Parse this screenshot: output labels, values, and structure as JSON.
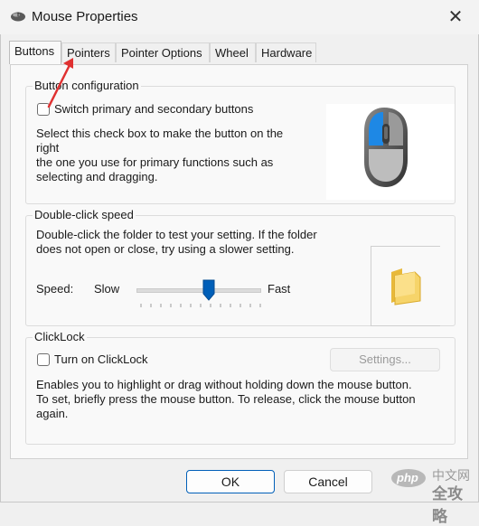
{
  "window": {
    "title": "Mouse Properties",
    "close_glyph": "✕"
  },
  "tabs": [
    {
      "label": "Buttons",
      "active": true
    },
    {
      "label": "Pointers"
    },
    {
      "label": "Pointer Options"
    },
    {
      "label": "Wheel"
    },
    {
      "label": "Hardware"
    }
  ],
  "button_config": {
    "group_label": "Button configuration",
    "checkbox_label": "Switch primary and secondary buttons",
    "checked": false,
    "description": [
      "Select this check box to make the button on the right",
      "the one you use for primary functions such as",
      "selecting and dragging."
    ]
  },
  "double_click": {
    "group_label": "Double-click speed",
    "description": [
      "Double-click the folder to test your setting. If the folder",
      "does not open or close, try using a slower setting."
    ],
    "speed_label": "Speed:",
    "slow_label": "Slow",
    "fast_label": "Fast",
    "speed_level": 0.55
  },
  "clicklock": {
    "group_label": "ClickLock",
    "checkbox_label": "Turn on ClickLock",
    "checked": false,
    "settings_label": "Settings...",
    "description": [
      "Enables you to highlight or drag without holding down the mouse button.",
      "To set, briefly press the mouse button. To release, click the mouse button",
      "again."
    ]
  },
  "footer": {
    "ok_label": "OK",
    "cancel_label": "Cancel"
  },
  "watermark": {
    "logo_text": "php",
    "site_text_top": "中文网",
    "site_text_bottom": "全攻略"
  },
  "colors": {
    "accent": "#005fb8",
    "annotation_arrow": "#e03131",
    "mouse_highlight": "#1e88e5"
  }
}
